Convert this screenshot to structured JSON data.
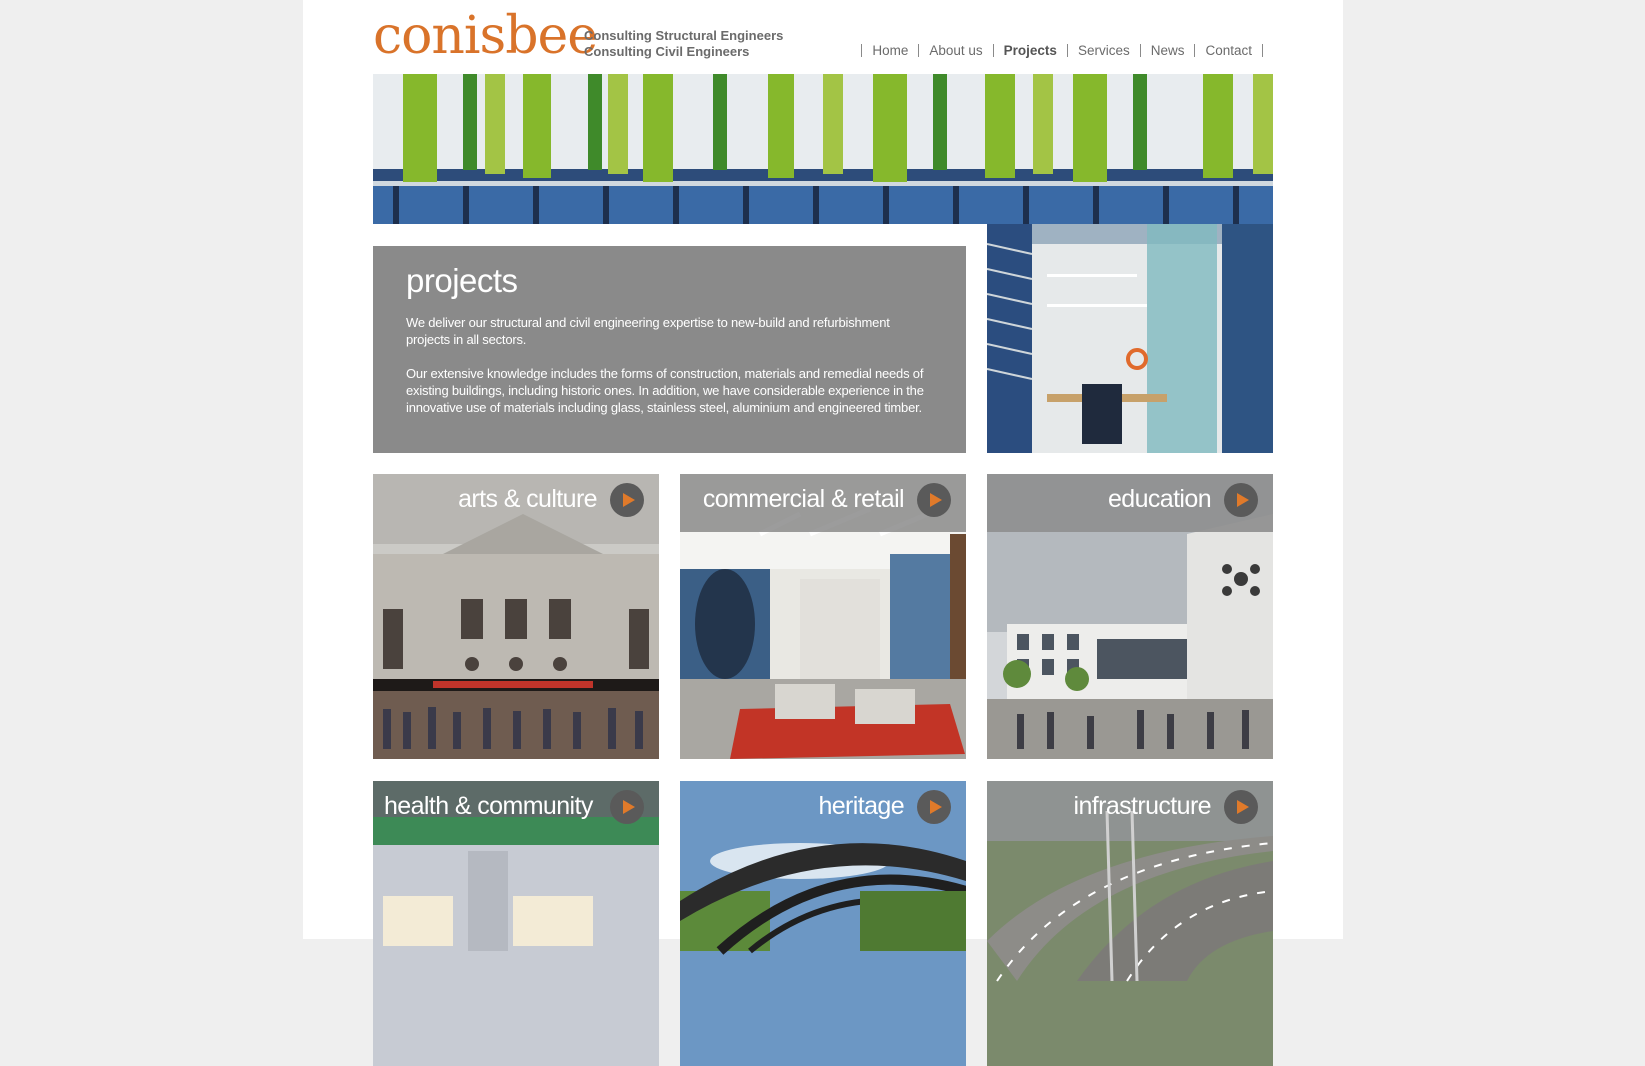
{
  "header": {
    "logo": "conisbee",
    "tagline_line1": "Consulting Structural Engineers",
    "tagline_line2": "Consulting Civil Engineers"
  },
  "nav": [
    {
      "label": "Home",
      "active": false
    },
    {
      "label": "About us",
      "active": false
    },
    {
      "label": "Projects",
      "active": true
    },
    {
      "label": "Services",
      "active": false
    },
    {
      "label": "News",
      "active": false
    },
    {
      "label": "Contact",
      "active": false
    }
  ],
  "intro": {
    "title": "projects",
    "para1": "We deliver our structural and civil engineering expertise to new-build and refurbishment projects in all sectors.",
    "para2": "Our extensive knowledge includes the forms of construction, materials and remedial needs of existing buildings, including historic ones. In addition, we have considerable experience in the innovative use of materials including glass, stainless steel, aluminium and engineered timber."
  },
  "tiles": [
    {
      "label": "arts & culture"
    },
    {
      "label": "commercial & retail"
    },
    {
      "label": "education"
    },
    {
      "label": "health & community"
    },
    {
      "label": "heritage"
    },
    {
      "label": "infrastructure"
    }
  ],
  "colors": {
    "brand": "#d9732a",
    "intro_bg": "#8a8a8a",
    "arrow": "#e07a2a"
  }
}
